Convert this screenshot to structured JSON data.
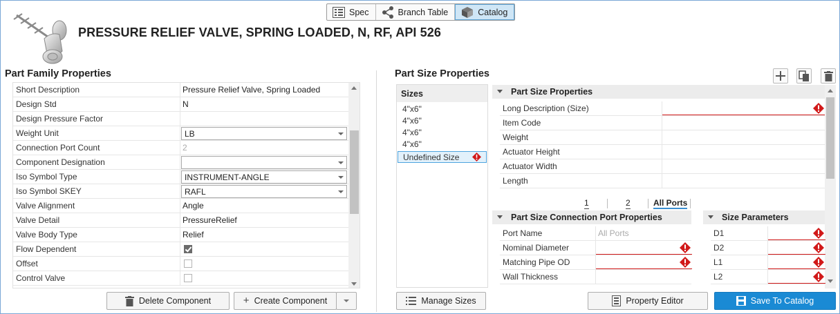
{
  "view_tabs": [
    {
      "label": "Spec",
      "icon": "list-icon",
      "active": false
    },
    {
      "label": "Branch Table",
      "icon": "share-icon",
      "active": false
    },
    {
      "label": "Catalog",
      "icon": "cube-icon",
      "active": true
    }
  ],
  "component_title": "PRESSURE RELIEF VALVE, SPRING LOADED, N, RF, API 526",
  "part_family": {
    "title": "Part Family Properties",
    "rows": [
      {
        "name": "Short Description",
        "type": "text",
        "value": "Pressure Relief Valve, Spring Loaded"
      },
      {
        "name": "Design Std",
        "type": "text",
        "value": "N"
      },
      {
        "name": "Design Pressure Factor",
        "type": "text",
        "value": ""
      },
      {
        "name": "Weight Unit",
        "type": "combo",
        "value": "LB"
      },
      {
        "name": "Connection Port Count",
        "type": "readonly",
        "value": "2"
      },
      {
        "name": "Component Designation",
        "type": "combo",
        "value": ""
      },
      {
        "name": "Iso Symbol Type",
        "type": "combo",
        "value": "INSTRUMENT-ANGLE"
      },
      {
        "name": "Iso Symbol SKEY",
        "type": "combo",
        "value": "RAFL"
      },
      {
        "name": "Valve Alignment",
        "type": "text",
        "value": "Angle"
      },
      {
        "name": "Valve Detail",
        "type": "text",
        "value": "PressureRelief"
      },
      {
        "name": "Valve Body Type",
        "type": "text",
        "value": "Relief"
      },
      {
        "name": "Flow Dependent",
        "type": "checkbox",
        "checked": true
      },
      {
        "name": "Offset",
        "type": "checkbox",
        "checked": false
      },
      {
        "name": "Control Valve",
        "type": "checkbox",
        "checked": false
      }
    ],
    "delete_label": "Delete Component",
    "create_label": "Create Component"
  },
  "part_size": {
    "title": "Part Size Properties",
    "sizes_header": "Sizes",
    "sizes": [
      "4\"x6\"",
      "4\"x6\"",
      "4\"x6\"",
      "4\"x6\""
    ],
    "undefined_size": "Undefined Size",
    "manage_sizes_label": "Manage Sizes",
    "properties_header": "Part Size Properties",
    "properties": [
      {
        "name": "Long Description (Size)",
        "error": true
      },
      {
        "name": "Item Code",
        "error": false
      },
      {
        "name": "Weight",
        "error": false
      },
      {
        "name": "Actuator Height",
        "error": false
      },
      {
        "name": "Actuator Width",
        "error": false
      },
      {
        "name": "Length",
        "error": false
      }
    ],
    "port_tabs": [
      "1",
      "2",
      "All Ports"
    ],
    "connection_header": "Part Size Connection Port Properties",
    "connection_rows": [
      {
        "name": "Port Name",
        "placeholder": "All Ports",
        "error": false
      },
      {
        "name": "Nominal Diameter",
        "placeholder": "",
        "error": true
      },
      {
        "name": "Matching Pipe OD",
        "placeholder": "",
        "error": true
      },
      {
        "name": "Wall Thickness",
        "placeholder": "",
        "error": false
      }
    ],
    "size_params_header": "Size Parameters",
    "size_params": [
      {
        "name": "D1",
        "error": true
      },
      {
        "name": "D2",
        "error": true
      },
      {
        "name": "L1",
        "error": true
      },
      {
        "name": "L2",
        "error": true
      }
    ],
    "property_editor_label": "Property Editor",
    "save_label": "Save To Catalog"
  },
  "colors": {
    "accent": "#1a8ad4",
    "error": "#d11919",
    "active_tab": "#cfe6f6"
  }
}
